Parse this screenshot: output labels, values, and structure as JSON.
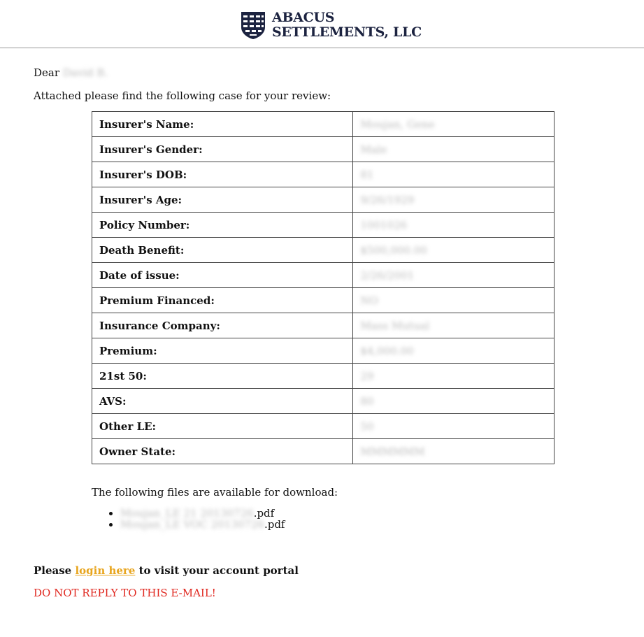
{
  "header": {
    "logo_line1": "ABACUS",
    "logo_line2": "SETTLEMENTS, LLC",
    "brand_color": "#1c2340"
  },
  "greeting": {
    "prefix": "Dear",
    "name": "David B."
  },
  "intro": "Attached please find the following case for your review:",
  "case_table": [
    {
      "label": "Insurer's Name:",
      "value": "Moujan, Gene"
    },
    {
      "label": "Insurer's Gender:",
      "value": "Male"
    },
    {
      "label": "Insurer's DOB:",
      "value": "81"
    },
    {
      "label": "Insurer's Age:",
      "value": "9/26/1929"
    },
    {
      "label": "Policy Number:",
      "value": "1001026"
    },
    {
      "label": "Death Benefit:",
      "value": "$500,000.00"
    },
    {
      "label": "Date of issue:",
      "value": "2/26/2001"
    },
    {
      "label": "Premium Financed:",
      "value": "NO"
    },
    {
      "label": "Insurance Company:",
      "value": "Mass Mutual"
    },
    {
      "label": "Premium:",
      "value": "$4,000.00"
    },
    {
      "label": "21st 50:",
      "value": "29"
    },
    {
      "label": "AVS:",
      "value": "80"
    },
    {
      "label": "Other LE:",
      "value": "50"
    },
    {
      "label": "Owner State:",
      "value": "MMMMMM"
    }
  ],
  "files_note": "The following files are available for download:",
  "files": [
    {
      "name": "Moujan_LE 21 20130726",
      "ext": ".pdf"
    },
    {
      "name": "Moujan_LE VOC 20130726",
      "ext": ".pdf"
    }
  ],
  "login": {
    "prefix": "Please",
    "link_text": "login here",
    "suffix": "to visit your account portal",
    "link_color": "#e8a51e"
  },
  "warning": {
    "text": "DO NOT REPLY TO THIS E-MAIL!",
    "color": "#e0271f"
  }
}
